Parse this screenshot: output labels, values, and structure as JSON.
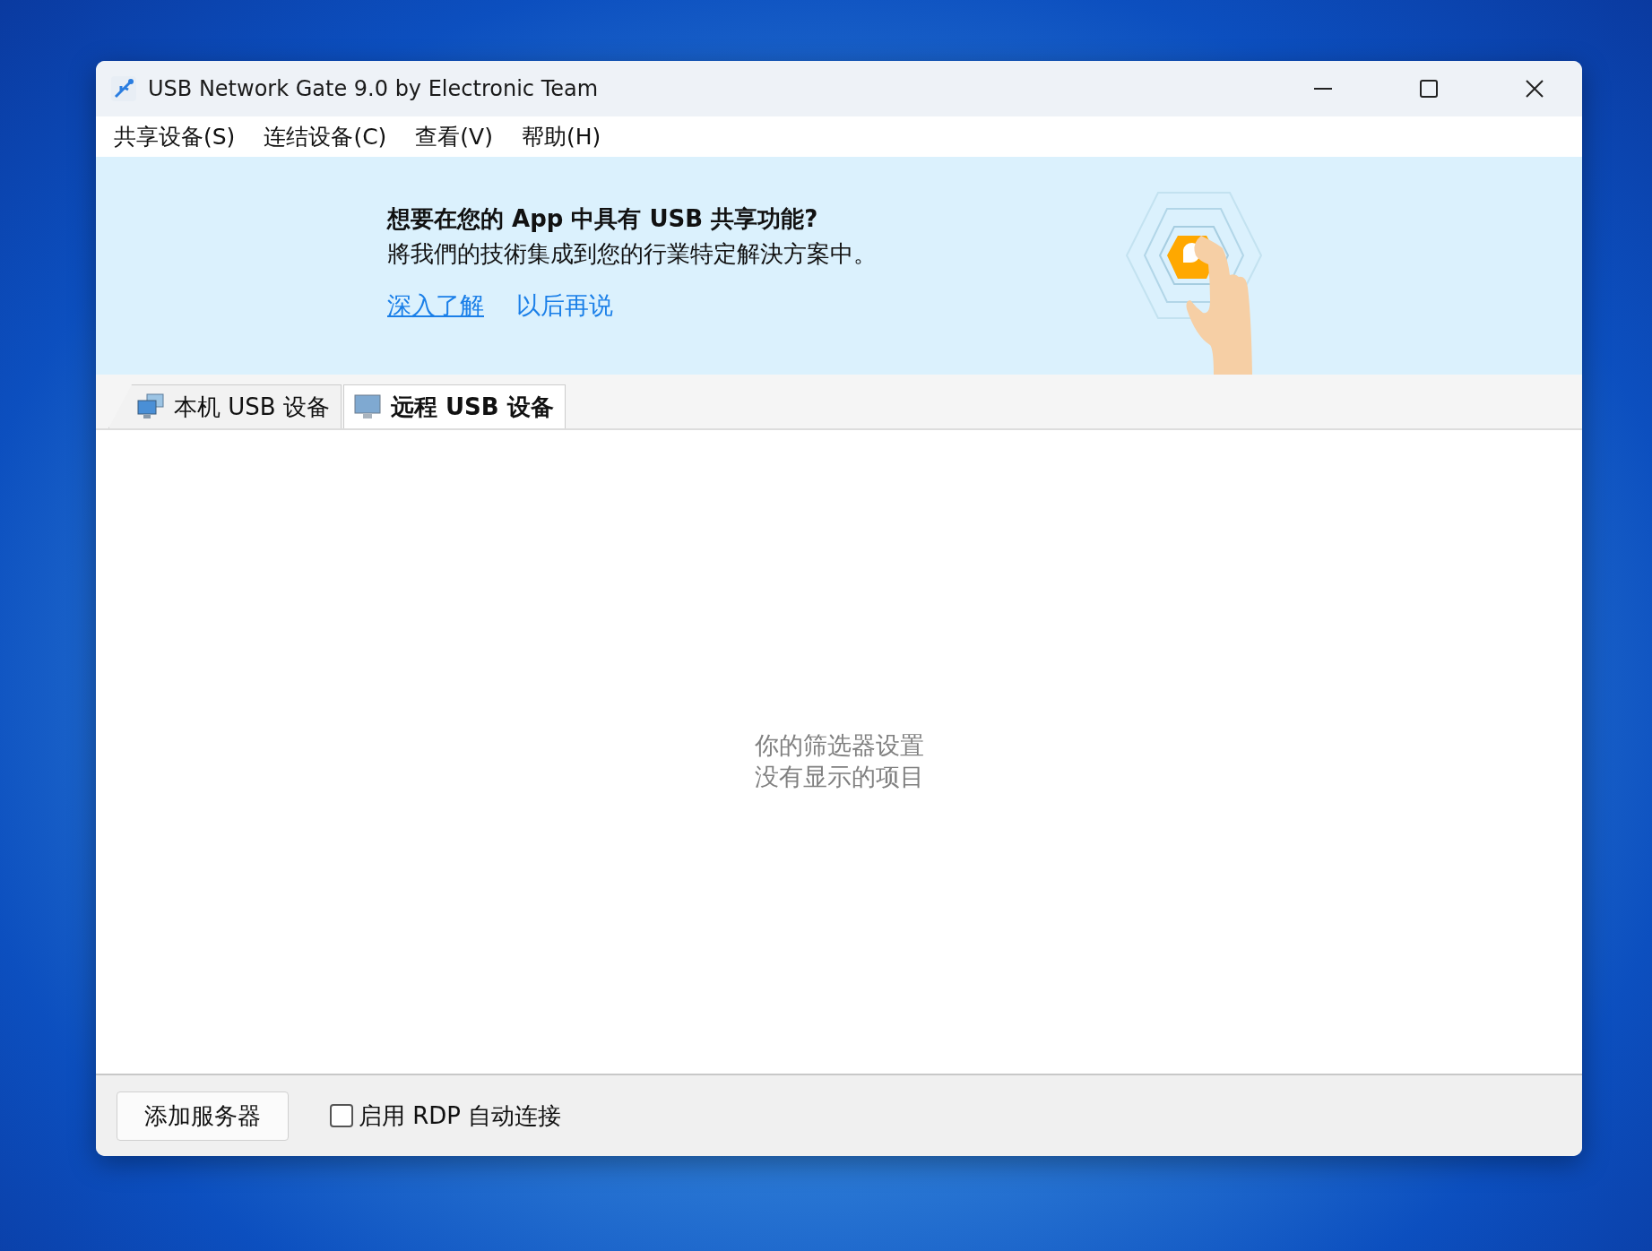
{
  "window": {
    "title": "USB Network Gate 9.0 by Electronic Team"
  },
  "menu": [
    "共享设备(S)",
    "连结设备(C)",
    "查看(V)",
    "帮助(H)"
  ],
  "banner": {
    "heading": "想要在您的 App 中具有 USB 共享功能?",
    "text": "將我們的技術集成到您的行業特定解決方案中。",
    "links": [
      {
        "label": "深入了解",
        "underlined": true
      },
      {
        "label": "以后再说",
        "underlined": false
      }
    ]
  },
  "tabs": [
    {
      "label": "本机 USB 设备",
      "kind": "local",
      "selected": false
    },
    {
      "label": "远程 USB 设备",
      "kind": "remote",
      "selected": true
    }
  ],
  "empty_message": [
    "你的筛选器设置",
    "没有显示的项目"
  ],
  "footer": {
    "button": "添加服务器",
    "checkbox": {
      "label": "启用 RDP 自动连接",
      "checked": false
    }
  }
}
